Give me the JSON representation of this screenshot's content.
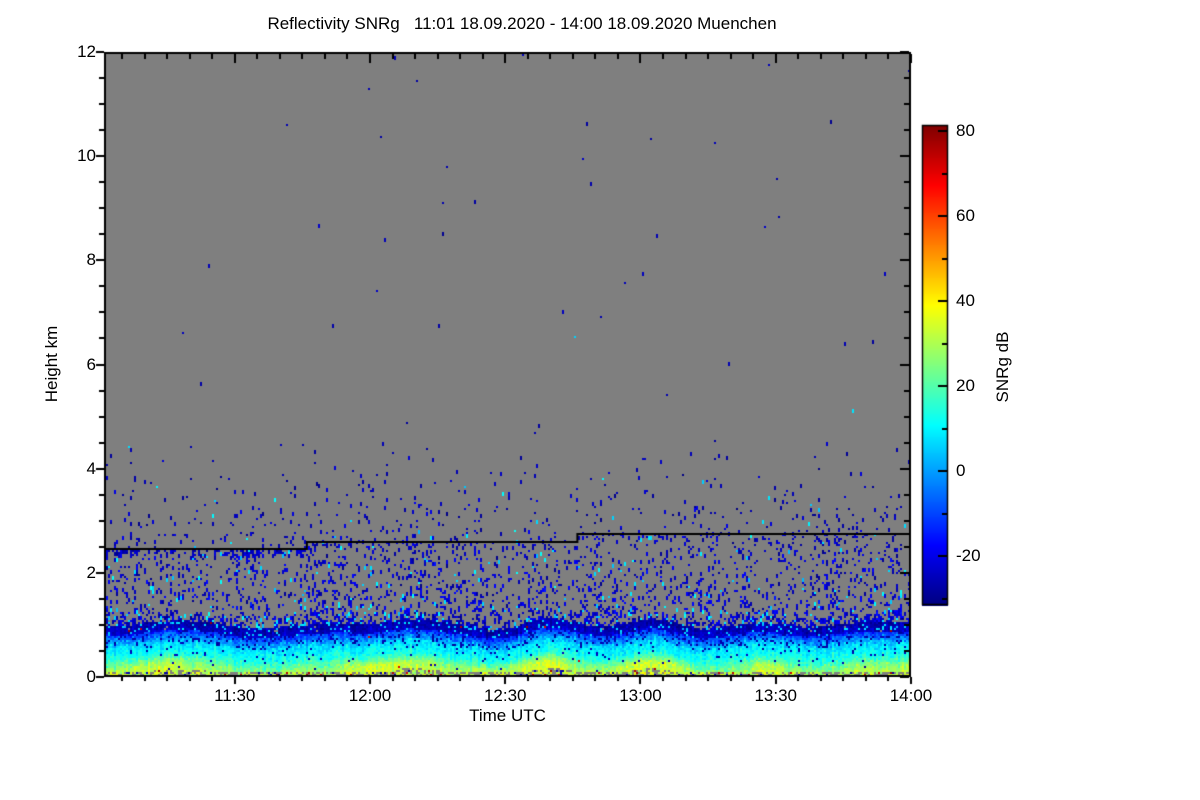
{
  "figure": {
    "title": "Reflectivity SNRg   11:01 18.09.2020 - 14:00 18.09.2020 Muenchen",
    "background_color": "#ffffff",
    "station": "Muenchen",
    "time_start": "11:01 18.09.2020",
    "time_end": "14:00 18.09.2020"
  },
  "chart_data": {
    "type": "heatmap",
    "title": "Reflectivity SNRg   11:01 18.09.2020 - 14:00 18.09.2020 Muenchen",
    "xlabel": "Time UTC",
    "ylabel": "Height km",
    "x_start": "11:01",
    "x_end": "14:00",
    "x_duration_min": 179,
    "x_tick_labels": [
      "11:30",
      "12:00",
      "12:30",
      "13:00",
      "13:30",
      "14:00"
    ],
    "x_tick_minutes": [
      29,
      59,
      89,
      119,
      149,
      179
    ],
    "x_minor_step_min": 5,
    "ylim": [
      0,
      12
    ],
    "y_tick_values": [
      0,
      2,
      4,
      6,
      8,
      10,
      12
    ],
    "y_tick_labels": [
      "0",
      "2",
      "4",
      "6",
      "8",
      "10",
      "12"
    ],
    "y_minor_step_km": 0.5,
    "grid": false,
    "no_data_color": "#7f7f7f",
    "colormap": "jet",
    "value_range_db": [
      -31.5,
      81.5
    ],
    "colorbar": {
      "label": "SNRg dB",
      "tick_values": [
        -20,
        0,
        20,
        40,
        60,
        80
      ],
      "tick_labels": [
        "-20",
        "0",
        "20",
        "40",
        "60",
        "80"
      ],
      "minor_tick_values": [
        -30,
        -10,
        10,
        30,
        50,
        70
      ],
      "position": "right"
    },
    "cloud_base_line": {
      "color": "#000000",
      "segments": [
        {
          "start_min": 0,
          "end_min": 45,
          "height_km": 2.46
        },
        {
          "start_min": 45,
          "end_min": 105,
          "height_km": 2.6
        },
        {
          "start_min": 105,
          "end_min": 179,
          "height_km": 2.75
        }
      ]
    },
    "isolated_echoes": [
      {
        "time_min": 23,
        "height_km": 7.9,
        "snr_db": -25
      },
      {
        "time_min": 62,
        "height_km": 8.4,
        "snr_db": -25
      },
      {
        "time_min": 166,
        "height_km": 5.1,
        "snr_db": 8
      }
    ],
    "speckle_bands": [
      {
        "h0": 4.55,
        "h1": 12.01,
        "p0": 0.0007,
        "p1": 0.0007,
        "v": -26,
        "vs": 3,
        "cyan": 0.02
      },
      {
        "h0": 3.6,
        "h1": 4.55,
        "p0": 0.016,
        "p1": 0.002,
        "v": -26,
        "vs": 4,
        "cyan": 0.04
      },
      {
        "h0": 2.8,
        "h1": 3.6,
        "p0": 0.04,
        "p1": 0.016,
        "v": -25,
        "vs": 5,
        "cyan": 0.05
      },
      {
        "h0": 2.3,
        "h1": 2.8,
        "p0": 0.085,
        "p1": 0.05,
        "v": -24,
        "vs": 5,
        "cyan": 0.06
      },
      {
        "h0": 1.55,
        "h1": 2.3,
        "p0": 0.11,
        "p1": 0.095,
        "v": -23,
        "vs": 6,
        "cyan": 0.09
      },
      {
        "h0": 1.25,
        "h1": 1.55,
        "p0": 0.15,
        "p1": 0.12,
        "v": -22,
        "vs": 6,
        "cyan": 0.12
      },
      {
        "h0": 1.02,
        "h1": 1.25,
        "p0": 0.45,
        "p1": 0.17,
        "v": -23,
        "vs": 6,
        "cyan": 0.15
      }
    ],
    "surface_layers": [
      {
        "h0": 0.84,
        "h1": 1.02,
        "v0": -24,
        "v1": -27,
        "n": 5,
        "blue": 0,
        "cyan": 0.1,
        "gray": 0.012,
        "maroon": 0.004
      },
      {
        "h0": 0.6,
        "h1": 0.84,
        "v0": 7,
        "v1": -13,
        "n": 9,
        "blue": 0.16,
        "cyan": 0,
        "gray": 0,
        "maroon": 0.001
      },
      {
        "h0": 0.36,
        "h1": 0.6,
        "v0": 14,
        "v1": 7,
        "n": 6,
        "blue": 0.05,
        "cyan": 0,
        "gray": 0,
        "maroon": 0
      },
      {
        "h0": 0.14,
        "h1": 0.36,
        "v0": 26,
        "v1": 14,
        "n": 7,
        "blue": 0.01,
        "cyan": 0,
        "gray": 0,
        "maroon": 0.001
      },
      {
        "h0": 0.08,
        "h1": 0.14,
        "v0": 30,
        "v1": 26,
        "n": 5,
        "blue": 0.005,
        "cyan": 0,
        "gray": 0,
        "maroon": 0.002
      },
      {
        "h0": -0.01,
        "h1": 0.08,
        "v0": 32,
        "v1": 30,
        "n": 8,
        "blue": 0.06,
        "cyan": 0,
        "gray": 0.45,
        "maroon": 0.03
      }
    ],
    "line_halo": {
      "width_km": 0.12,
      "extra_p_first_segment": 0.28,
      "extra_p_later": 0.1
    },
    "yellow_patches": {
      "zone_h_max": 0.4,
      "max_boost_db": 13
    },
    "seed": 20200918
  }
}
